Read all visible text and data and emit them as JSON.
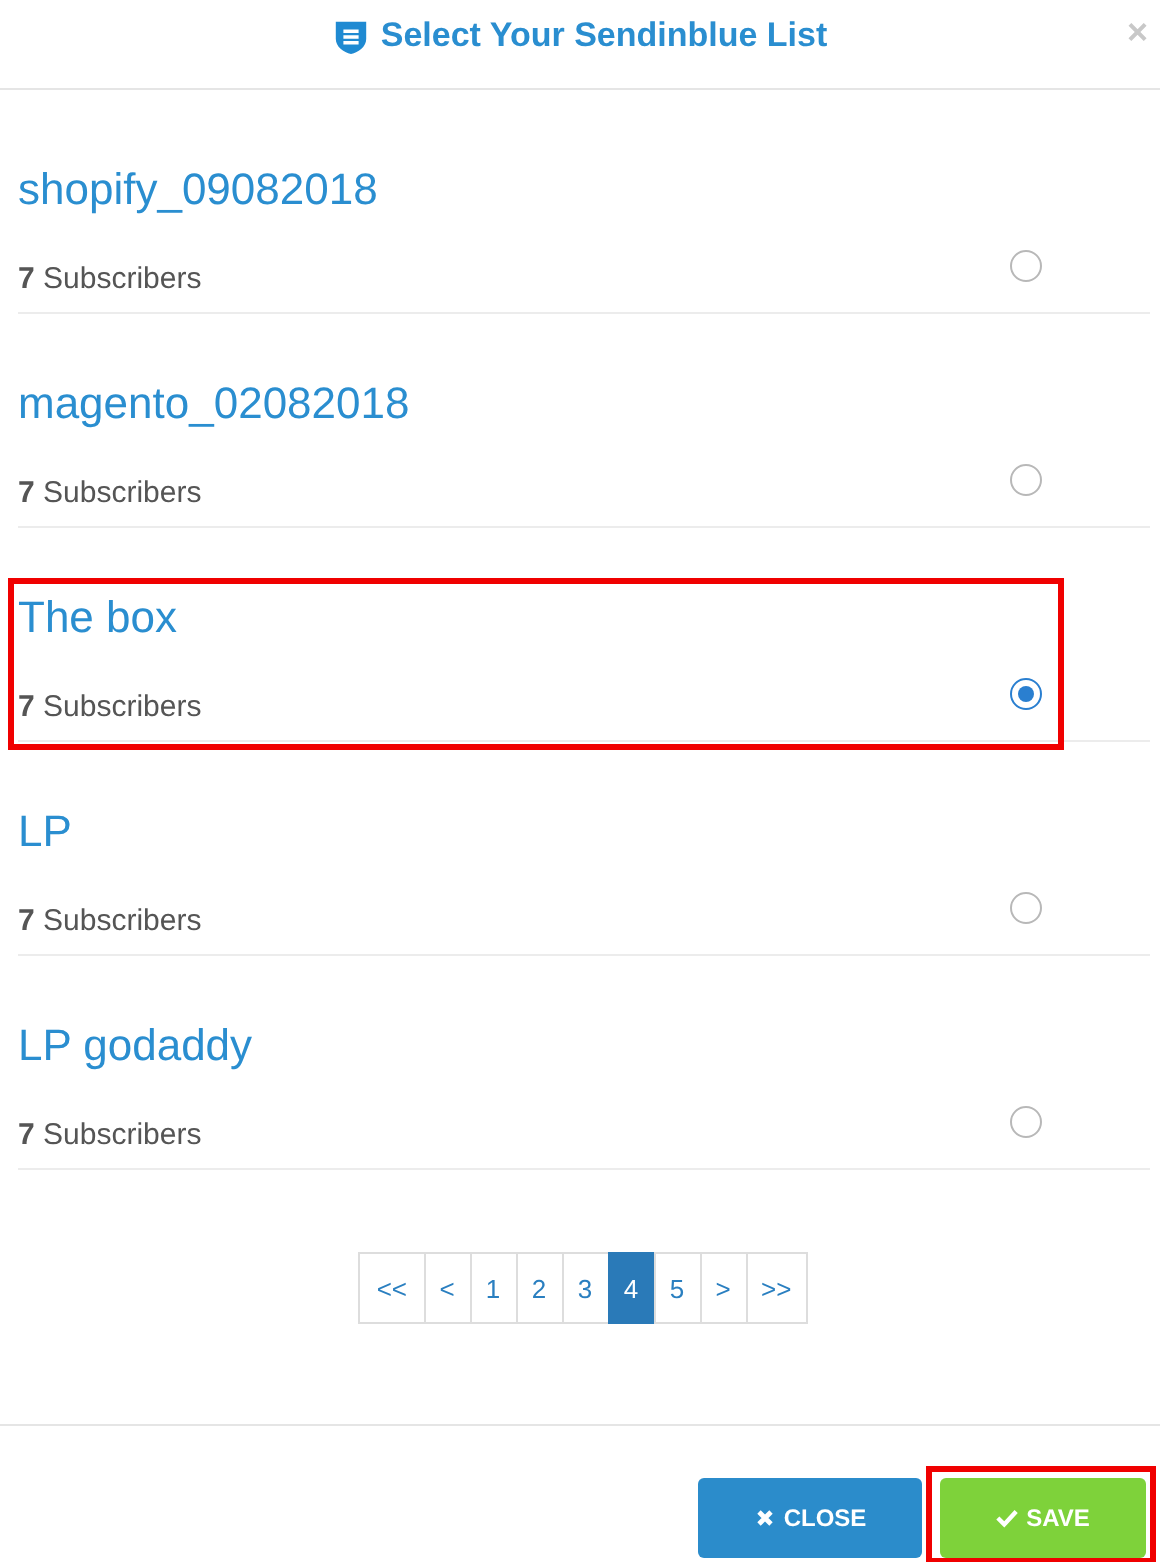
{
  "dialog": {
    "title": "Select Your Sendinblue List",
    "close_icon": "×"
  },
  "lists": [
    {
      "name": "shopify_09082018",
      "subscribers": "**7** Subscribers",
      "selected": false,
      "highlighted": false
    },
    {
      "name": "magento_02082018",
      "subscribers": "**7** Subscribers",
      "selected": false,
      "highlighted": false
    },
    {
      "name": "The box",
      "subscribers": "**7** Subscribers",
      "selected": true,
      "highlighted": true
    },
    {
      "name": "LP",
      "subscribers": "**7** Subscribers",
      "selected": false,
      "highlighted": false
    },
    {
      "name": "LP godaddy",
      "subscribers": "**7** Subscribers",
      "selected": false,
      "highlighted": false
    }
  ],
  "pagination": [
    {
      "label": "<<",
      "selected": false
    },
    {
      "label": "<",
      "selected": false
    },
    {
      "label": "1",
      "selected": false
    },
    {
      "label": "2",
      "selected": false
    },
    {
      "label": "3",
      "selected": false
    },
    {
      "label": "4",
      "selected": true
    },
    {
      "label": "5",
      "selected": false
    },
    {
      "label": ">",
      "selected": false
    },
    {
      "label": ">>",
      "selected": false
    }
  ],
  "buttons": [
    {
      "kind": "close",
      "label": "CLOSE",
      "highlighted": false
    },
    {
      "kind": "save",
      "label": "SAVE",
      "highlighted": true
    }
  ]
}
